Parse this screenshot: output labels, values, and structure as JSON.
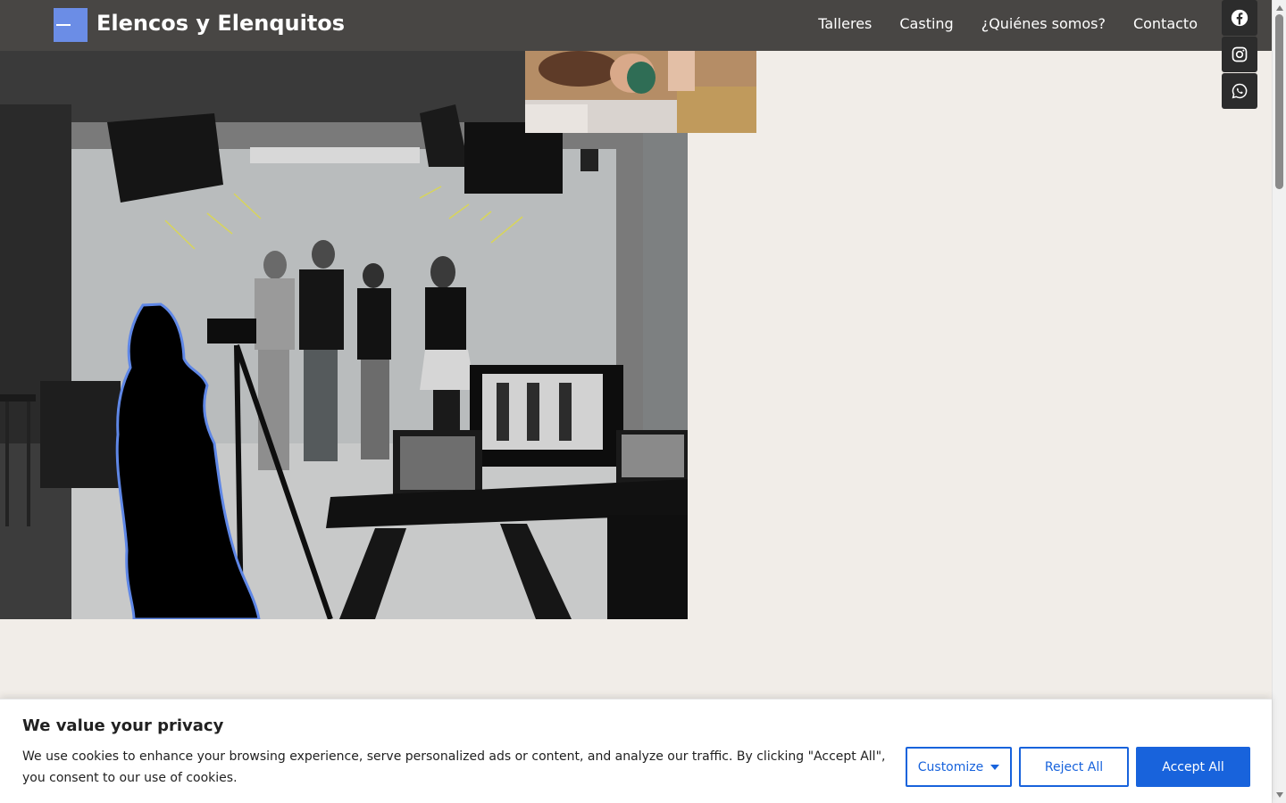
{
  "header": {
    "title": "Elencos y Elenquitos",
    "nav": [
      "Talleres",
      "Casting",
      "¿Quiénes somos?",
      "Contacto"
    ]
  },
  "social": [
    "facebook-icon",
    "instagram-icon",
    "whatsapp-icon"
  ],
  "hero": {
    "image": "studio-photo"
  },
  "cookie": {
    "title": "We value your privacy",
    "text": "We use cookies to enhance your browsing experience, serve personalized ads or content, and analyze our traffic. By clicking \"Accept All\", you consent to our use of cookies.",
    "customize_label": "Customize",
    "reject_label": "Reject All",
    "accept_label": "Accept All"
  },
  "colors": {
    "header_bg": "#484644",
    "page_bg": "#f1ede8",
    "logo_accent": "#6b8de6",
    "cookie_primary": "#1863dc"
  }
}
